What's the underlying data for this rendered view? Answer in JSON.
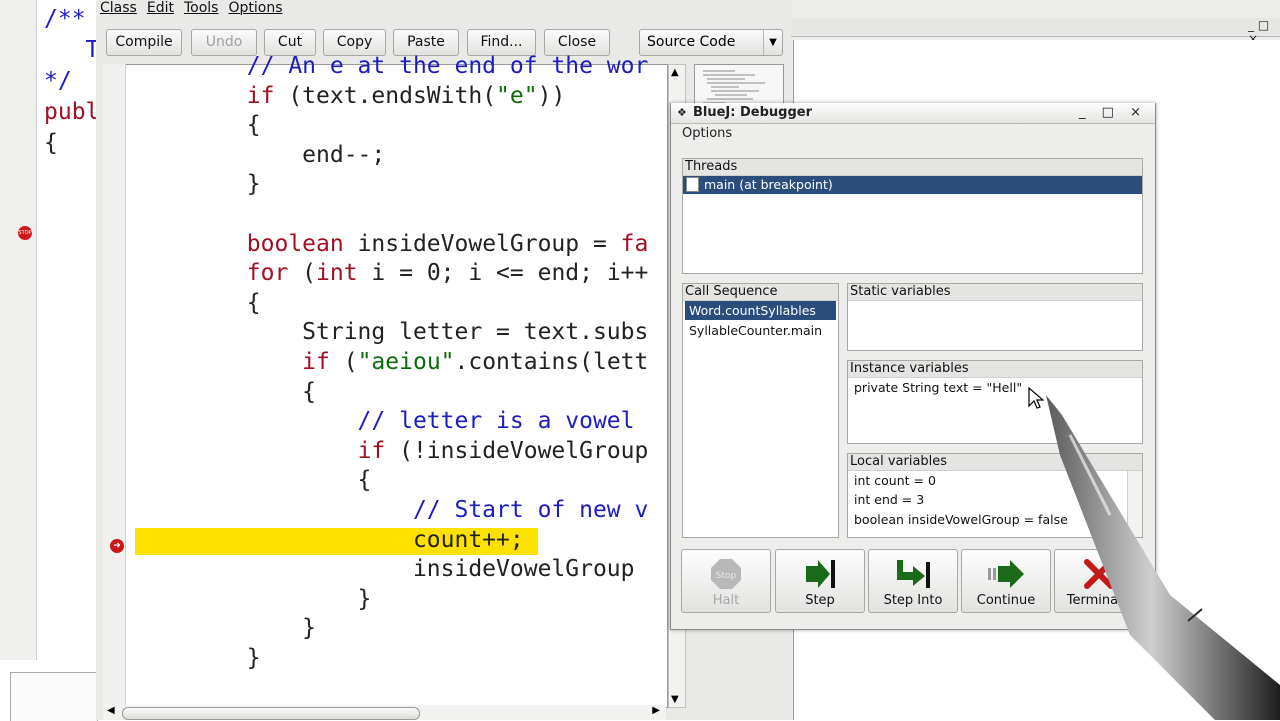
{
  "background_editor": {
    "code_lines": [
      {
        "parts": [
          {
            "t": "/**",
            "cls": "c"
          }
        ]
      },
      {
        "parts": [
          {
            "t": "   T",
            "cls": "c"
          }
        ]
      },
      {
        "parts": [
          {
            "t": "*/",
            "cls": "c"
          }
        ]
      },
      {
        "parts": [
          {
            "t": "publ",
            "cls": "k"
          }
        ]
      },
      {
        "parts": [
          {
            "t": "{",
            "cls": ""
          }
        ]
      }
    ],
    "stop_label": "STOP"
  },
  "editor": {
    "menu": [
      "Class",
      "Edit",
      "Tools",
      "Options"
    ],
    "toolbar": {
      "compile": "Compile",
      "undo": "Undo",
      "cut": "Cut",
      "copy": "Copy",
      "paste": "Paste",
      "find": "Find...",
      "close": "Close"
    },
    "view_select": "Source Code",
    "code_lines": [
      [
        {
          "t": "        // An e at the end of the wor",
          "cls": "c"
        }
      ],
      [
        {
          "t": "        ",
          "cls": ""
        },
        {
          "t": "if",
          "cls": "k"
        },
        {
          "t": " (text.endsWith(",
          "cls": ""
        },
        {
          "t": "\"e\"",
          "cls": "s"
        },
        {
          "t": "))",
          "cls": ""
        }
      ],
      [
        {
          "t": "        {",
          "cls": ""
        }
      ],
      [
        {
          "t": "            end--;",
          "cls": ""
        }
      ],
      [
        {
          "t": "        }",
          "cls": ""
        }
      ],
      [
        {
          "t": "",
          "cls": ""
        }
      ],
      [
        {
          "t": "        ",
          "cls": ""
        },
        {
          "t": "boolean",
          "cls": "k"
        },
        {
          "t": " insideVowelGroup = ",
          "cls": ""
        },
        {
          "t": "fa",
          "cls": "k"
        }
      ],
      [
        {
          "t": "        ",
          "cls": ""
        },
        {
          "t": "for",
          "cls": "k"
        },
        {
          "t": " (",
          "cls": ""
        },
        {
          "t": "int",
          "cls": "k"
        },
        {
          "t": " i = 0; i <= end; i++",
          "cls": ""
        }
      ],
      [
        {
          "t": "        {",
          "cls": ""
        }
      ],
      [
        {
          "t": "            String letter = text.subs",
          "cls": ""
        }
      ],
      [
        {
          "t": "            ",
          "cls": ""
        },
        {
          "t": "if",
          "cls": "k"
        },
        {
          "t": " (",
          "cls": ""
        },
        {
          "t": "\"aeiou\"",
          "cls": "s"
        },
        {
          "t": ".contains(lett",
          "cls": ""
        }
      ],
      [
        {
          "t": "            {",
          "cls": ""
        }
      ],
      [
        {
          "t": "                // letter is a vowel",
          "cls": "c"
        }
      ],
      [
        {
          "t": "                ",
          "cls": ""
        },
        {
          "t": "if",
          "cls": "k"
        },
        {
          "t": " (!insideVowelGroup",
          "cls": ""
        }
      ],
      [
        {
          "t": "                {",
          "cls": ""
        }
      ],
      [
        {
          "t": "                    // Start of new v",
          "cls": "c"
        }
      ],
      [
        {
          "t": "                    count++;",
          "cls": ""
        }
      ],
      [
        {
          "t": "                    insideVowelGroup",
          "cls": ""
        }
      ],
      [
        {
          "t": "                }",
          "cls": ""
        }
      ],
      [
        {
          "t": "            }",
          "cls": ""
        }
      ],
      [
        {
          "t": "        }",
          "cls": ""
        }
      ]
    ],
    "current_line_index": 16
  },
  "debugger": {
    "title": "BlueJ:  Debugger",
    "window_controls": "_ □ ×",
    "menu": "Options",
    "threads": {
      "header": "Threads",
      "items": [
        "main (at breakpoint)"
      ],
      "selected": 0
    },
    "call_sequence": {
      "header": "Call Sequence",
      "items": [
        "Word.countSyllables",
        "SyllableCounter.main"
      ],
      "selected": 0
    },
    "static_variables": {
      "header": "Static variables",
      "items": []
    },
    "instance_variables": {
      "header": "Instance variables",
      "items": [
        "private String text = \"Hell\""
      ]
    },
    "local_variables": {
      "header": "Local variables",
      "items": [
        "int count = 0",
        "int end = 3",
        "boolean insideVowelGroup = false"
      ]
    },
    "buttons": {
      "halt": "Halt",
      "step": "Step",
      "step_into": "Step Into",
      "continue": "Continue",
      "terminate": "Terminate"
    },
    "halt_icon_text": "Stop"
  },
  "colors": {
    "selection": "#2a4d7b",
    "highlight": "#ffe100",
    "keyword": "#a01020",
    "comment": "#1c1cc0",
    "string": "#0a6b0a"
  }
}
